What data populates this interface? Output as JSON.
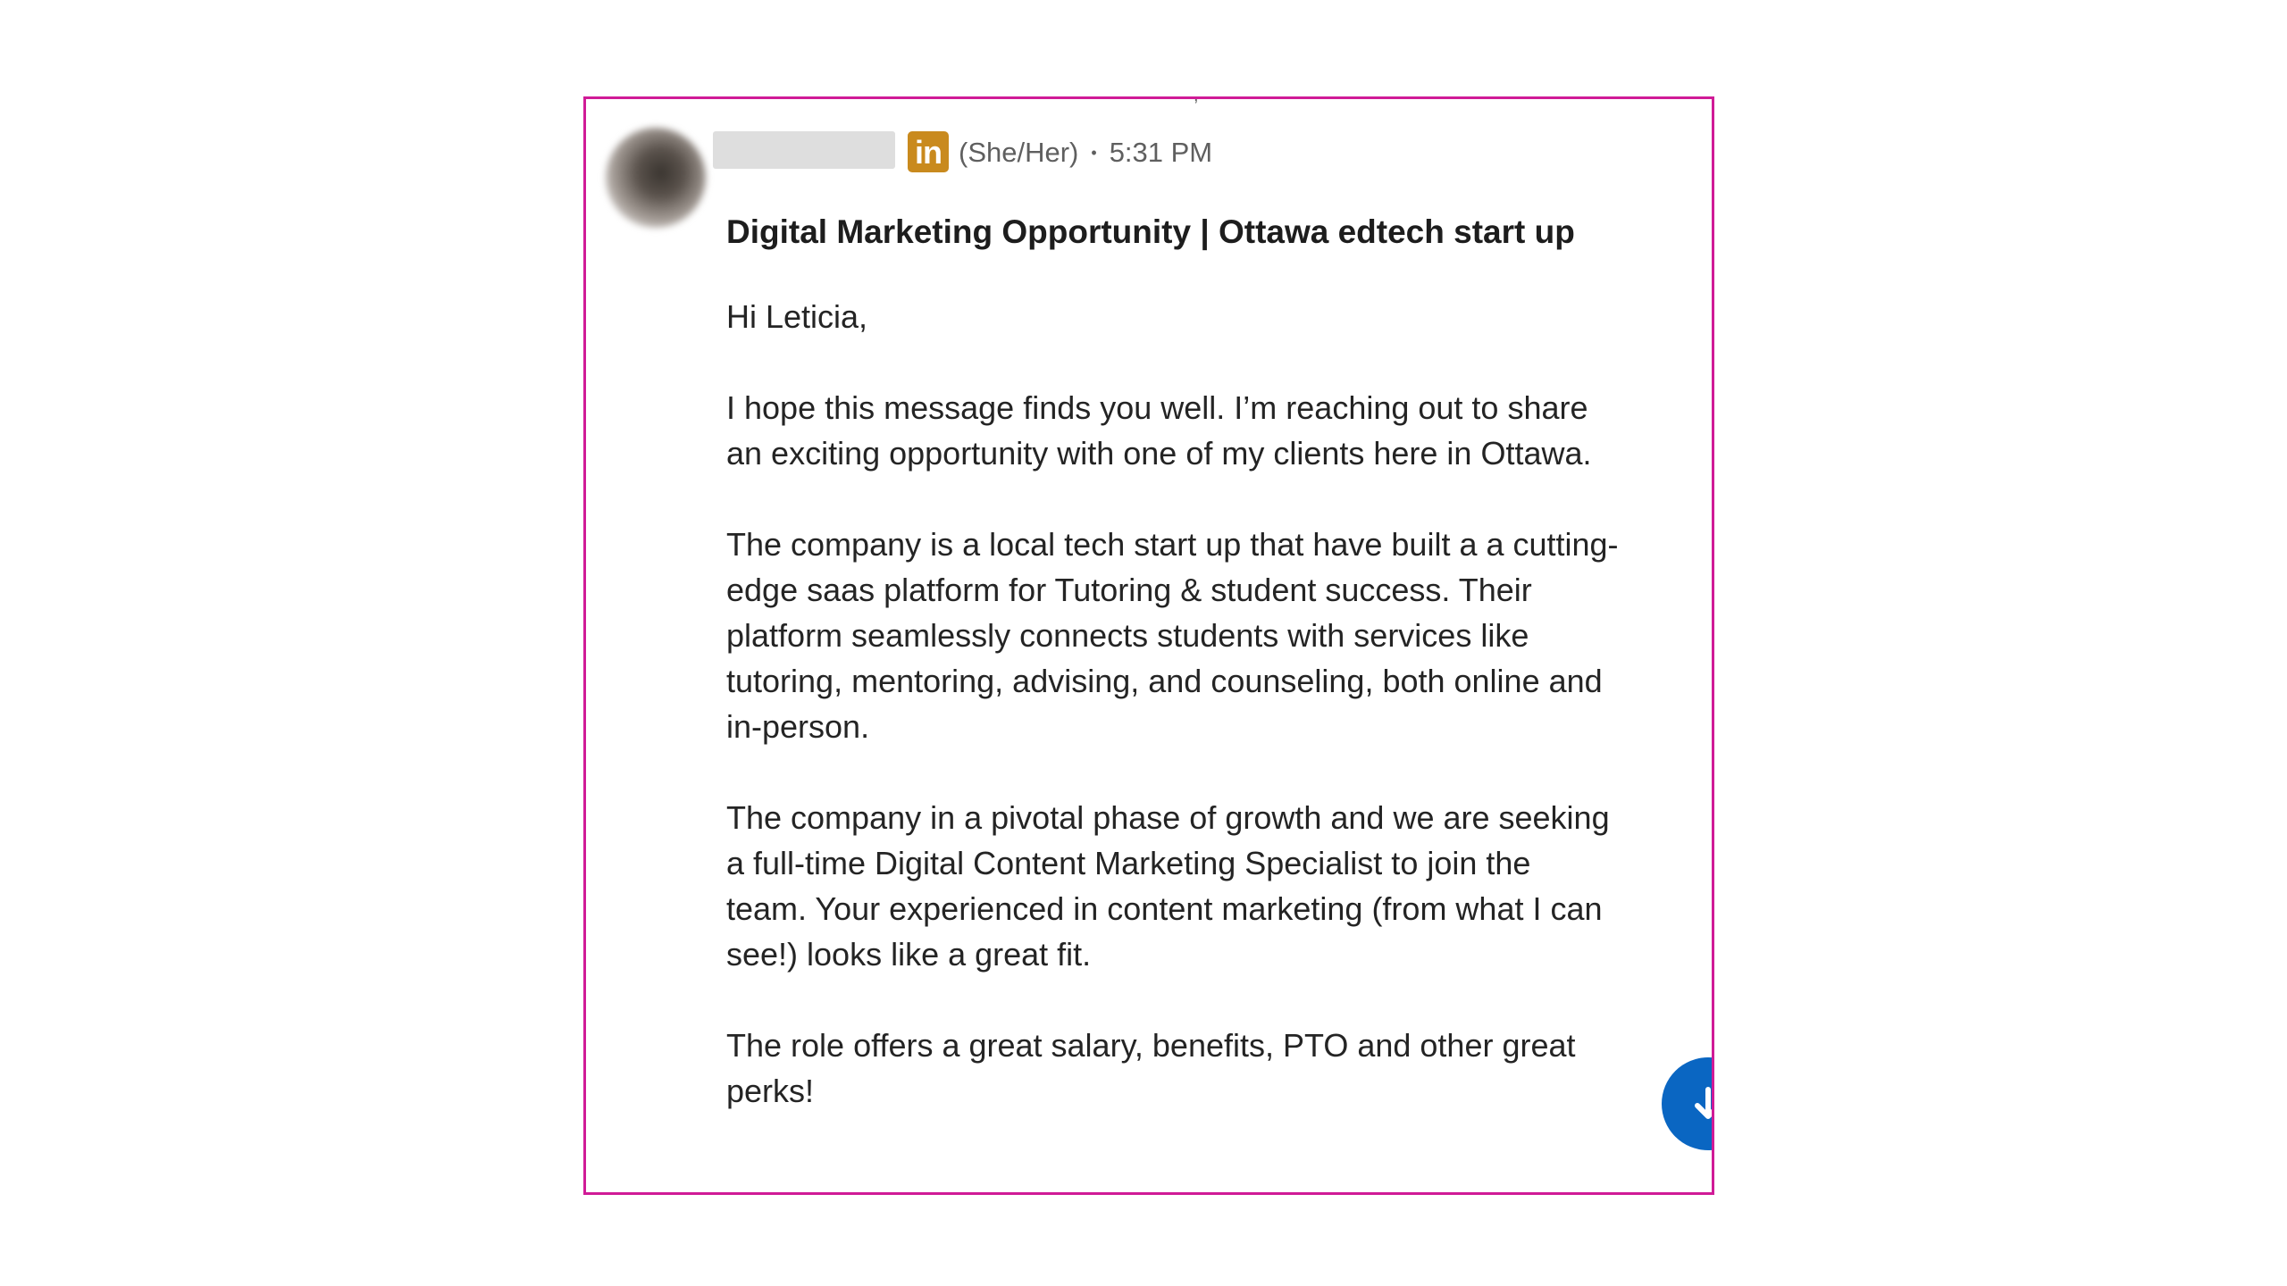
{
  "message": {
    "sender_pronouns": "(She/Her)",
    "separator": "•",
    "timestamp": "5:31 PM",
    "linkedin_badge": "in",
    "subject": "Digital Marketing Opportunity | Ottawa edtech start up",
    "paragraphs": [
      "Hi Leticia,",
      "I hope this message finds you well. I’m reaching out to share an exciting opportunity with one of my clients here in Ottawa.",
      "The company is a local tech start up that have built a a cutting-edge saas platform for Tutoring & student success. Their platform seamlessly connects students with services like tutoring, mentoring, advising, and counseling, both online and in-person.",
      "The company in a pivotal phase of growth and we are seeking a full-time Digital Content Marketing Specialist to join the team. Your experienced in content marketing (from what I can see!) looks like a great fit.",
      "The role offers a great salary, benefits, PTO and other great perks!"
    ]
  },
  "icons": {
    "avatar": "avatar-blurred",
    "badge": "linkedin-icon",
    "scroll": "arrow-down-icon"
  },
  "colors": {
    "highlight_border": "#d01b97",
    "linkedin_badge": "#c98a1e",
    "scroll_button": "#0a66c2"
  }
}
